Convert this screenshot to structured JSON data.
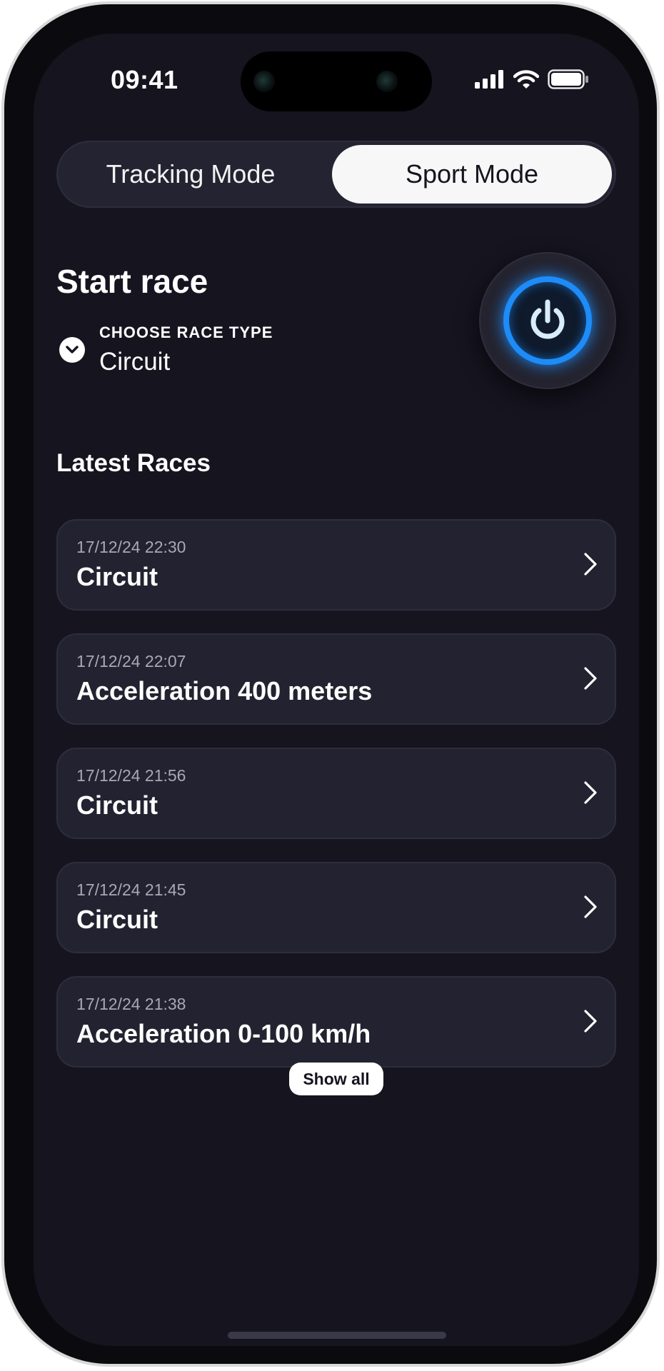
{
  "status_bar": {
    "time": "09:41",
    "icons": [
      "signal-icon",
      "wifi-icon",
      "battery-icon"
    ]
  },
  "mode_switch": {
    "options": [
      "Tracking Mode",
      "Sport Mode"
    ],
    "selected": "Sport Mode"
  },
  "start_race": {
    "title": "Start race",
    "race_type_label": "CHOOSE RACE TYPE",
    "race_type_value": "Circuit",
    "power_icon": "power-icon"
  },
  "latest_races": {
    "title": "Latest Races",
    "items": [
      {
        "date": "17/12/24 22:30",
        "name": "Circuit"
      },
      {
        "date": "17/12/24 22:07",
        "name": "Acceleration 400 meters"
      },
      {
        "date": "17/12/24 21:56",
        "name": "Circuit"
      },
      {
        "date": "17/12/24 21:45",
        "name": "Circuit"
      },
      {
        "date": "17/12/24 21:38",
        "name": "Acceleration 0-100 km/h"
      }
    ],
    "show_all_label": "Show all"
  },
  "colors": {
    "background": "#15141f",
    "card": "#232230",
    "accent": "#1d8cf8"
  }
}
